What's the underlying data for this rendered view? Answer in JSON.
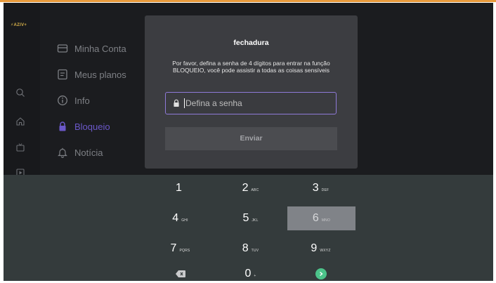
{
  "app": {
    "logo_text": "AZIV+"
  },
  "rail": {
    "icons": [
      "search-icon",
      "home-icon",
      "tv-icon",
      "play-icon"
    ]
  },
  "menu": {
    "items": [
      {
        "label": "Minha Conta",
        "icon": "account-icon",
        "active": false
      },
      {
        "label": "Meus planos",
        "icon": "plans-icon",
        "active": false
      },
      {
        "label": "Info",
        "icon": "info-icon",
        "active": false
      },
      {
        "label": "Bloqueio",
        "icon": "lock-icon",
        "active": true
      },
      {
        "label": "Notícia",
        "icon": "bell-icon",
        "active": false
      }
    ]
  },
  "dialog": {
    "title": "fechadura",
    "message": "Por favor, defina a senha de 4 dígitos para entrar na função BLOQUEIO, você pode assistir a todas as coisas sensíveis",
    "password": {
      "value": "",
      "placeholder": "Defina a senha"
    },
    "submit_label": "Enviar"
  },
  "keyboard": {
    "keys": [
      {
        "num": "1",
        "sub": ""
      },
      {
        "num": "2",
        "sub": "ABC"
      },
      {
        "num": "3",
        "sub": "DEF"
      },
      {
        "num": "4",
        "sub": "GHI"
      },
      {
        "num": "5",
        "sub": "JKL"
      },
      {
        "num": "6",
        "sub": "MNO"
      },
      {
        "num": "7",
        "sub": "PQRS"
      },
      {
        "num": "8",
        "sub": "TUV"
      },
      {
        "num": "9",
        "sub": "WXYZ"
      },
      {
        "num": "0",
        "sub": "+"
      }
    ],
    "focused_key": "6",
    "delete_icon": "backspace-icon",
    "go_icon": "go-icon"
  },
  "colors": {
    "accent": "#6b58c9",
    "field_border": "#8f7ad9",
    "go": "#4cc38a",
    "top_line": "#e89a3c"
  }
}
